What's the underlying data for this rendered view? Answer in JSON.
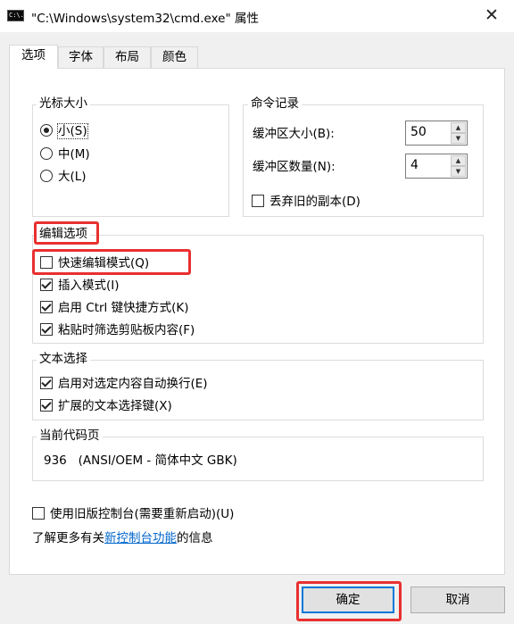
{
  "window": {
    "icon_text": "C:\\.",
    "title": "\"C:\\Windows\\system32\\cmd.exe\" 属性",
    "close_glyph": "✕"
  },
  "tabs": [
    {
      "label": "选项",
      "active": true
    },
    {
      "label": "字体",
      "active": false
    },
    {
      "label": "布局",
      "active": false
    },
    {
      "label": "颜色",
      "active": false
    }
  ],
  "cursor_size": {
    "title": "光标大小",
    "options": [
      {
        "label": "小(S)",
        "checked": true
      },
      {
        "label": "中(M)",
        "checked": false
      },
      {
        "label": "大(L)",
        "checked": false
      }
    ]
  },
  "command_history": {
    "title": "命令记录",
    "buffer_size_label": "缓冲区大小(B):",
    "buffer_size_value": "50",
    "buffer_count_label": "缓冲区数量(N):",
    "buffer_count_value": "4",
    "discard_old_label": "丢弃旧的副本(D)",
    "discard_old_checked": false
  },
  "edit_options": {
    "title": "编辑选项",
    "items": [
      {
        "label": "快速编辑模式(Q)",
        "checked": false
      },
      {
        "label": "插入模式(I)",
        "checked": true
      },
      {
        "label": "启用 Ctrl 键快捷方式(K)",
        "checked": true
      },
      {
        "label": "粘贴时筛选剪贴板内容(F)",
        "checked": true
      }
    ]
  },
  "text_selection": {
    "title": "文本选择",
    "items": [
      {
        "label": "启用对选定内容自动换行(E)",
        "checked": true
      },
      {
        "label": "扩展的文本选择键(X)",
        "checked": true
      }
    ]
  },
  "code_page": {
    "title": "当前代码页",
    "value": "936   (ANSI/OEM - 简体中文 GBK)"
  },
  "legacy_console": {
    "label": "使用旧版控制台(需要重新启动)(U)",
    "checked": false
  },
  "learn_more": {
    "prefix": "了解更多有关",
    "link": "新控制台功能",
    "suffix": "的信息"
  },
  "buttons": {
    "ok": "确定",
    "cancel": "取消"
  },
  "colors": {
    "highlight": "#e8302f",
    "link": "#0066cc",
    "default_button_border": "#0078d7"
  }
}
